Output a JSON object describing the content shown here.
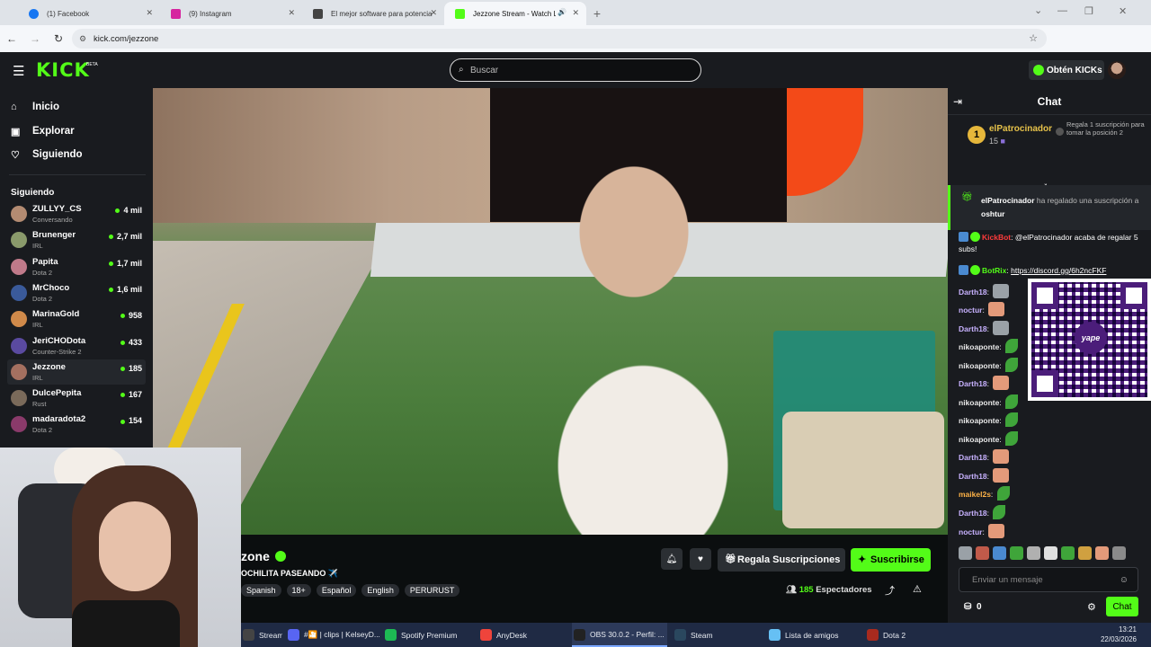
{
  "browser": {
    "tabs": [
      {
        "label": "(1) Facebook",
        "icon": "facebook-icon",
        "color": "#1877f2"
      },
      {
        "label": "(9) Instagram",
        "icon": "instagram-icon",
        "color": "#d6249f"
      },
      {
        "label": "El mejor software para potencia",
        "icon": "site-icon",
        "color": "#444444"
      },
      {
        "label": "Jezzone Stream - Watch Liv",
        "icon": "kick-icon",
        "color": "#53fc18"
      }
    ],
    "url": "kick.com/jezzone"
  },
  "header": {
    "logo": "KICK",
    "beta": "BETA",
    "search_placeholder": "Buscar",
    "kicks_button": "Obtén KICKs"
  },
  "sidebar": {
    "nav": [
      {
        "label": "Inicio",
        "icon": "home-icon"
      },
      {
        "label": "Explorar",
        "icon": "compass-icon"
      },
      {
        "label": "Siguiendo",
        "icon": "heart-icon"
      }
    ],
    "following_title": "Siguiendo",
    "channels": [
      {
        "name": "ZULLYY_CS",
        "sub": "Conversando",
        "viewers": "4 mil",
        "color": "#b38b72"
      },
      {
        "name": "Brunenger",
        "sub": "IRL",
        "viewers": "2,7 mil",
        "color": "#8a9a6b"
      },
      {
        "name": "Papita",
        "sub": "Dota 2",
        "viewers": "1,7 mil",
        "color": "#c07a8a"
      },
      {
        "name": "MrChoco",
        "sub": "Dota 2",
        "viewers": "1,6 mil",
        "color": "#3a5a9a"
      },
      {
        "name": "MarinaGold",
        "sub": "IRL",
        "viewers": "958",
        "color": "#d08a4a"
      },
      {
        "name": "JeriCHODota",
        "sub": "Counter-Strike 2",
        "viewers": "433",
        "color": "#5a4aa0"
      },
      {
        "name": "Jezzone",
        "sub": "IRL",
        "viewers": "185",
        "color": "#a47060"
      },
      {
        "name": "DulcePepita",
        "sub": "Rust",
        "viewers": "167",
        "color": "#7a6a5a"
      },
      {
        "name": "madaradota2",
        "sub": "Dota 2",
        "viewers": "154",
        "color": "#8a3a6a"
      }
    ]
  },
  "stream": {
    "name": "zone",
    "title": "OCHILITA PASEANDO ✈️",
    "tags": [
      "Spanish",
      "18+",
      "Español",
      "English",
      "PERURUST"
    ],
    "gift_button": "Regala Suscripciones",
    "subscribe_button": "Suscribirse",
    "viewers": "185",
    "viewers_label": "Espectadores"
  },
  "chat": {
    "title": "Chat",
    "patron": {
      "rank": "1",
      "name": "elPatrocinador",
      "count": "15",
      "hint": "Regala 1 suscripción para tomar la posición 2"
    },
    "pinned": {
      "user": "elPatrocinador",
      "text": "ha regalado una suscripción a",
      "target": "oshtur"
    },
    "messages": [
      {
        "user": "KickBot",
        "color": "#ff3b3b",
        "text": "@elPatrocinador acaba de regalar 5 subs!"
      },
      {
        "user": "BotRix",
        "color": "#53fc18",
        "link": "https://discord.gg/6h2ncFKF"
      },
      {
        "user": "Darth18",
        "color": "#c8b2ff",
        "emote": "cat"
      },
      {
        "user": "noctur",
        "color": "#c8b2ff",
        "emote": "face"
      },
      {
        "user": "Darth18",
        "color": "#c8b2ff",
        "emote": "cat"
      },
      {
        "user": "nikoaponte",
        "color": "#e8e8e8",
        "emote": "leaf"
      },
      {
        "user": "nikoaponte",
        "color": "#e8e8e8",
        "emote": "leaf"
      },
      {
        "user": "Darth18",
        "color": "#c8b2ff",
        "emote": "face"
      },
      {
        "user": "nikoaponte",
        "color": "#e8e8e8",
        "emote": "leaf"
      },
      {
        "user": "nikoaponte",
        "color": "#e8e8e8",
        "emote": "leaf"
      },
      {
        "user": "nikoaponte",
        "color": "#e8e8e8",
        "emote": "leaf"
      },
      {
        "user": "Darth18",
        "color": "#c8b2ff",
        "emote": "face"
      },
      {
        "user": "Darth18",
        "color": "#c8b2ff",
        "emote": "face"
      },
      {
        "user": "maikel2s",
        "color": "#ffb347",
        "emote": "leaf"
      },
      {
        "user": "Darth18",
        "color": "#c8b2ff",
        "emote": "leaf"
      },
      {
        "user": "noctur",
        "color": "#c8b2ff",
        "emote": "face"
      }
    ],
    "qr_logo": "yape",
    "input_placeholder": "Enviar un mensaje",
    "kicks_count": "0",
    "send_button": "Chat"
  },
  "taskbar": {
    "items": [
      {
        "label": "Stream ...",
        "color": "#444444"
      },
      {
        "label": "#🎦 | clips | KelseyD...",
        "color": "#5865f2"
      },
      {
        "label": "Spotify Premium",
        "color": "#1db954"
      },
      {
        "label": "AnyDesk",
        "color": "#ef443b"
      },
      {
        "label": "OBS 30.0.2 - Perfil: ...",
        "color": "#222222"
      },
      {
        "label": "Steam",
        "color": "#2a475e"
      },
      {
        "label": "Lista de amigos",
        "color": "#66c0f4"
      },
      {
        "label": "Dota 2",
        "color": "#a82a1e"
      }
    ],
    "time": "13:21",
    "date": "22/03/2026"
  }
}
